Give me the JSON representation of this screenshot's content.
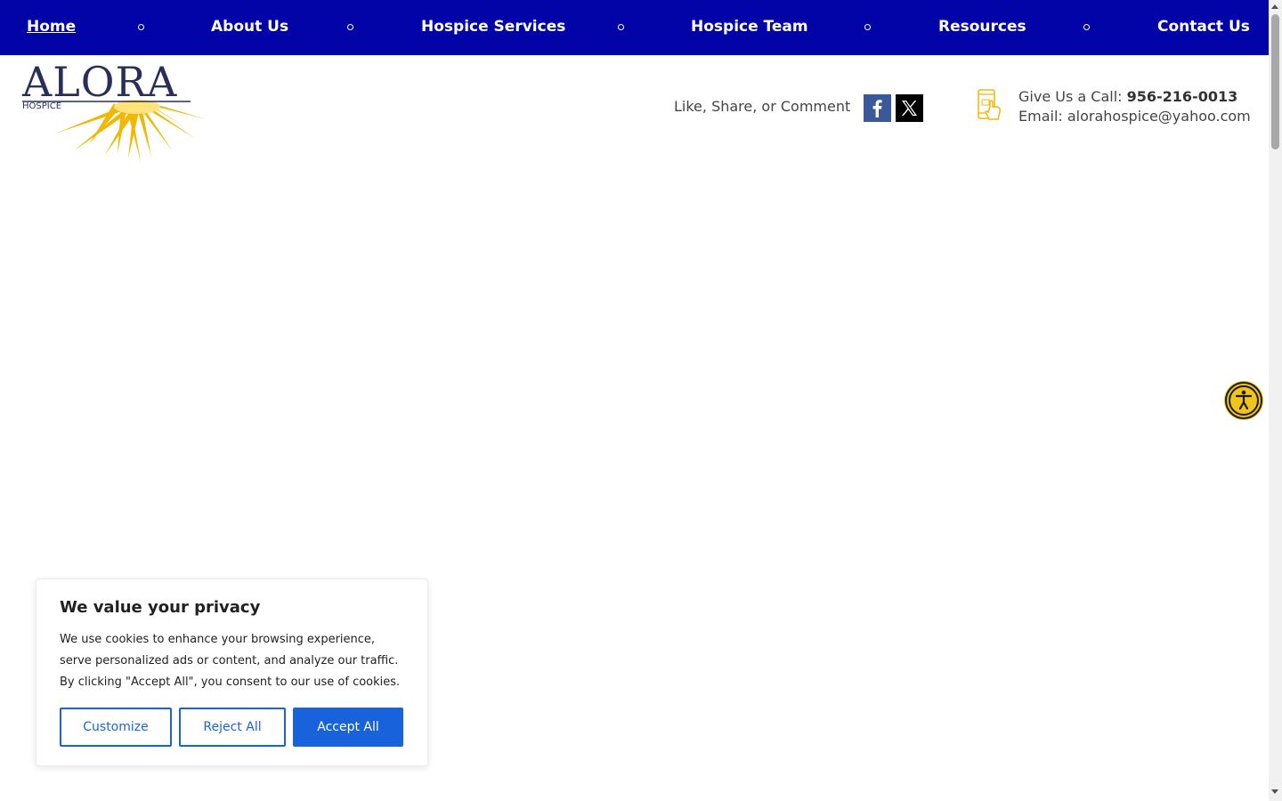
{
  "nav": {
    "items": [
      {
        "label": "Home",
        "active": true
      },
      {
        "label": "About Us"
      },
      {
        "label": "Hospice Services"
      },
      {
        "label": "Hospice Team"
      },
      {
        "label": "Resources"
      },
      {
        "label": "Contact Us"
      }
    ],
    "background_color": "#0304a8"
  },
  "header": {
    "logo": {
      "name": "ALORA",
      "sub": "HOSPICE"
    },
    "social": {
      "label": "Like, Share, or Comment",
      "icons": [
        "facebook-icon",
        "x-twitter-icon"
      ]
    },
    "contact": {
      "call_label": "Give Us a Call: ",
      "phone": "956-216-0013",
      "email_line": "Email: alorahospice@yahoo.com",
      "icon": "phone-icon"
    }
  },
  "accessibility": {
    "icon": "accessibility-icon",
    "color": "#f0c419"
  },
  "cookie": {
    "title": "We value your privacy",
    "text": "We use cookies to enhance your browsing experience, serve personalized ads or content, and analyze our traffic. By clicking \"Accept All\", you consent to our use of cookies.",
    "customize_label": "Customize",
    "reject_label": "Reject All",
    "accept_label": "Accept All",
    "accent_color": "#1863dc"
  }
}
